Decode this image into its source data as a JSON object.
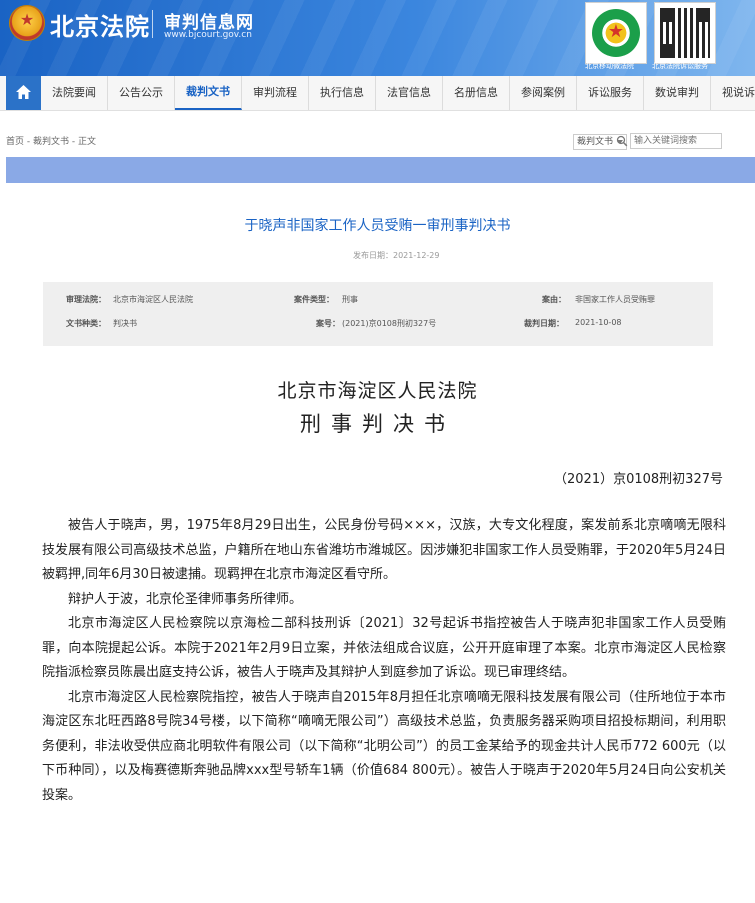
{
  "header": {
    "site_name": "北京法院",
    "sub_name": "审判信息网",
    "sub_url": "www.bjcourt.gov.cn",
    "qr_captions": [
      "北京移动微法院",
      "北京法院诉讼服务"
    ]
  },
  "nav": {
    "home_icon": "home-icon",
    "items": [
      "法院要闻",
      "公告公示",
      "裁判文书",
      "审判流程",
      "执行信息",
      "法官信息",
      "名册信息",
      "参阅案例",
      "诉讼服务",
      "数说审判",
      "视说诉讼"
    ],
    "active_index": 2
  },
  "breadcrumb": "首页 - 裁判文书 - 正文",
  "search": {
    "type_label": "裁判文书",
    "placeholder": "输入关键词搜索"
  },
  "document": {
    "title": "于晓声非国家工作人员受贿一审刑事判决书",
    "publish_date": "发布日期：2021-12-29",
    "meta": {
      "court_label": "审理法院：",
      "court_value": "北京市海淀区人民法院",
      "case_type_label": "案件类型：",
      "case_type_value": "刑事",
      "cause_label": "案由：",
      "cause_value": "非国家工作人员受贿罪",
      "doc_type_label": "文书种类：",
      "doc_type_value": "判决书",
      "case_no_label": "案号：",
      "case_no_value": "(2021)京0108刑初327号",
      "date_label": "裁判日期：",
      "date_value": "2021-10-08"
    },
    "court_name": "北京市海淀区人民法院",
    "doc_type": "刑事判决书",
    "case_number": "（2021）京0108刑初327号",
    "paragraphs": [
      "被告人于晓声，男，1975年8月29日出生，公民身份号码×××，汉族，大专文化程度，案发前系北京嘀嘀无限科技发展有限公司高级技术总监，户籍所在地山东省潍坊市潍城区。因涉嫌犯非国家工作人员受贿罪，于2020年5月24日被羁押,同年6月30日被逮捕。现羁押在北京市海淀区看守所。",
      "辩护人于波，北京伦圣律师事务所律师。",
      "北京市海淀区人民检察院以京海检二部科技刑诉〔2021〕32号起诉书指控被告人于晓声犯非国家工作人员受贿罪，向本院提起公诉。本院于2021年2月9日立案，并依法组成合议庭，公开开庭审理了本案。北京市海淀区人民检察院指派检察员陈晨出庭支持公诉，被告人于晓声及其辩护人到庭参加了诉讼。现已审理终结。",
      "北京市海淀区人民检察院指控，被告人于晓声自2015年8月担任北京嘀嘀无限科技发展有限公司（住所地位于本市海淀区东北旺西路8号院34号楼，以下简称“嘀嘀无限公司”）高级技术总监，负责服务器采购项目招投标期间，利用职务便利，非法收受供应商北明软件有限公司（以下简称“北明公司”）的员工金某给予的现金共计人民币772 600元（以下币种同），以及梅赛德斯奔驰品牌xxx型号轿车1辆（价值684 800元）。被告人于晓声于2020年5月24日向公安机关投案。"
    ]
  }
}
